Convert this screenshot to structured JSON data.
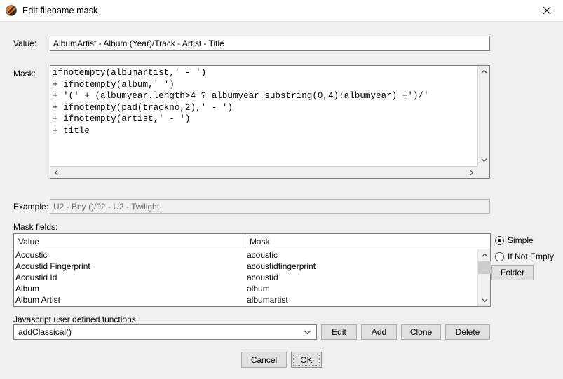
{
  "window": {
    "title": "Edit filename mask",
    "icon": "app-logo-icon",
    "close_label": "✕"
  },
  "value_field": {
    "label": "Value:",
    "value": "AlbumArtist - Album (Year)/Track - Artist - Title"
  },
  "mask_field": {
    "label": "Mask:",
    "lines": [
      "ifnotempty(albumartist,' - ')",
      "+ ifnotempty(album,' ')",
      "+ '(' + (albumyear.length>4 ? albumyear.substring(0,4):albumyear) +')/'",
      "+ ifnotempty(pad(trackno,2),' - ')",
      "+ ifnotempty(artist,' - ')",
      "+ title"
    ],
    "text": "ifnotempty(albumartist,' - ')\n+ ifnotempty(album,' ')\n+ '(' + (albumyear.length>4 ? albumyear.substring(0,4):albumyear) +')/'\n+ ifnotempty(pad(trackno,2),' - ')\n+ ifnotempty(artist,' - ')\n+ title"
  },
  "example_field": {
    "label": "Example:",
    "value": "U2 - Boy ()/02 - U2 - Twilight"
  },
  "mask_fields": {
    "label": "Mask fields:",
    "columns": [
      "Value",
      "Mask"
    ],
    "rows": [
      {
        "value": "Acoustic",
        "mask": "acoustic"
      },
      {
        "value": "Acoustid Fingerprint",
        "mask": "acoustidfingerprint"
      },
      {
        "value": "Acoustid Id",
        "mask": "acoustid"
      },
      {
        "value": "Album",
        "mask": "album"
      },
      {
        "value": "Album Artist",
        "mask": "albumartist"
      }
    ]
  },
  "options": {
    "radios": [
      {
        "label": "Simple",
        "checked": true
      },
      {
        "label": "If Not Empty",
        "checked": false
      }
    ],
    "folder_button": "Folder"
  },
  "javascript_functions": {
    "label": "Javascript user defined functions",
    "selected": "addClassical()",
    "buttons": [
      "Edit",
      "Add",
      "Clone",
      "Delete"
    ]
  },
  "dialog_buttons": {
    "cancel": "Cancel",
    "ok": "OK"
  }
}
